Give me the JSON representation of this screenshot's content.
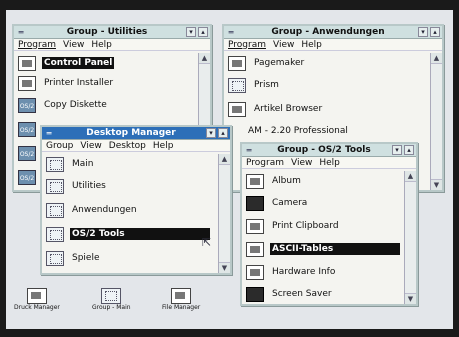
{
  "utilities": {
    "title": "Group - Utilities",
    "menu": [
      "Program",
      "View",
      "Help"
    ],
    "items": [
      "Control Panel",
      "Printer Installer",
      "Copy Diskette"
    ]
  },
  "anwendungen": {
    "title": "Group - Anwendungen",
    "menu": [
      "Program",
      "View",
      "Help"
    ],
    "items": [
      "Pagemaker",
      "Prism",
      "Artikel Browser",
      "AM - 2.20 Professional"
    ]
  },
  "desktop_manager": {
    "title": "Desktop Manager",
    "menu": [
      "Group",
      "View",
      "Desktop",
      "Help"
    ],
    "items": [
      "Main",
      "Utilities",
      "Anwendungen",
      "OS/2 Tools",
      "Spiele"
    ]
  },
  "os2tools": {
    "title": "Group - OS/2 Tools",
    "menu": [
      "Program",
      "View",
      "Help"
    ],
    "items": [
      "Album",
      "Camera",
      "Print Clipboard",
      "ASCII-Tables",
      "Hardware Info",
      "Screen Saver"
    ]
  },
  "desktop_icons": [
    "Druck Manager",
    "Group - Main",
    "File Manager"
  ],
  "icons": {
    "os2_label": "OS/2"
  }
}
